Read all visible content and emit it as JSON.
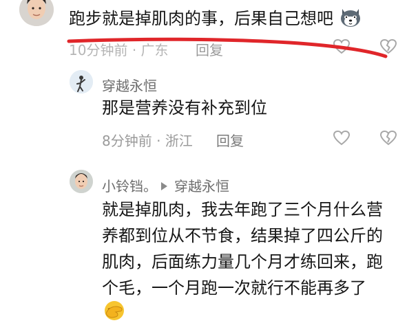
{
  "comments": [
    {
      "text": "跑步就是掉肌肉的事，后果自己想吧",
      "time": "10分钟前",
      "location": "广东",
      "reply_label": "回复"
    },
    {
      "username": "穿越永恒",
      "text": "那是营养没有补充到位",
      "time": "8分钟前",
      "location": "浙江",
      "reply_label": "回复"
    },
    {
      "username": "小铃铛。",
      "reply_to": "穿越永恒",
      "text_lines": [
        "就是掉肌肉，我去年跑了三个月什么营",
        "养都到位从不节食，结果掉了四公斤的",
        "肌肉，后面练力量几个月才练回来，跑",
        "个毛，一个月跑一次就行不能再多了"
      ]
    }
  ],
  "separator": "·",
  "colors": {
    "annotation_red": "#e0262a",
    "meta_gray": "#9a9a9a"
  },
  "icons": {
    "emoji_dog": "dog-emoji-icon",
    "emoji_facepalm": "facepalm-emoji-icon",
    "like": "heart-outline-icon",
    "dislike": "broken-heart-icon"
  }
}
